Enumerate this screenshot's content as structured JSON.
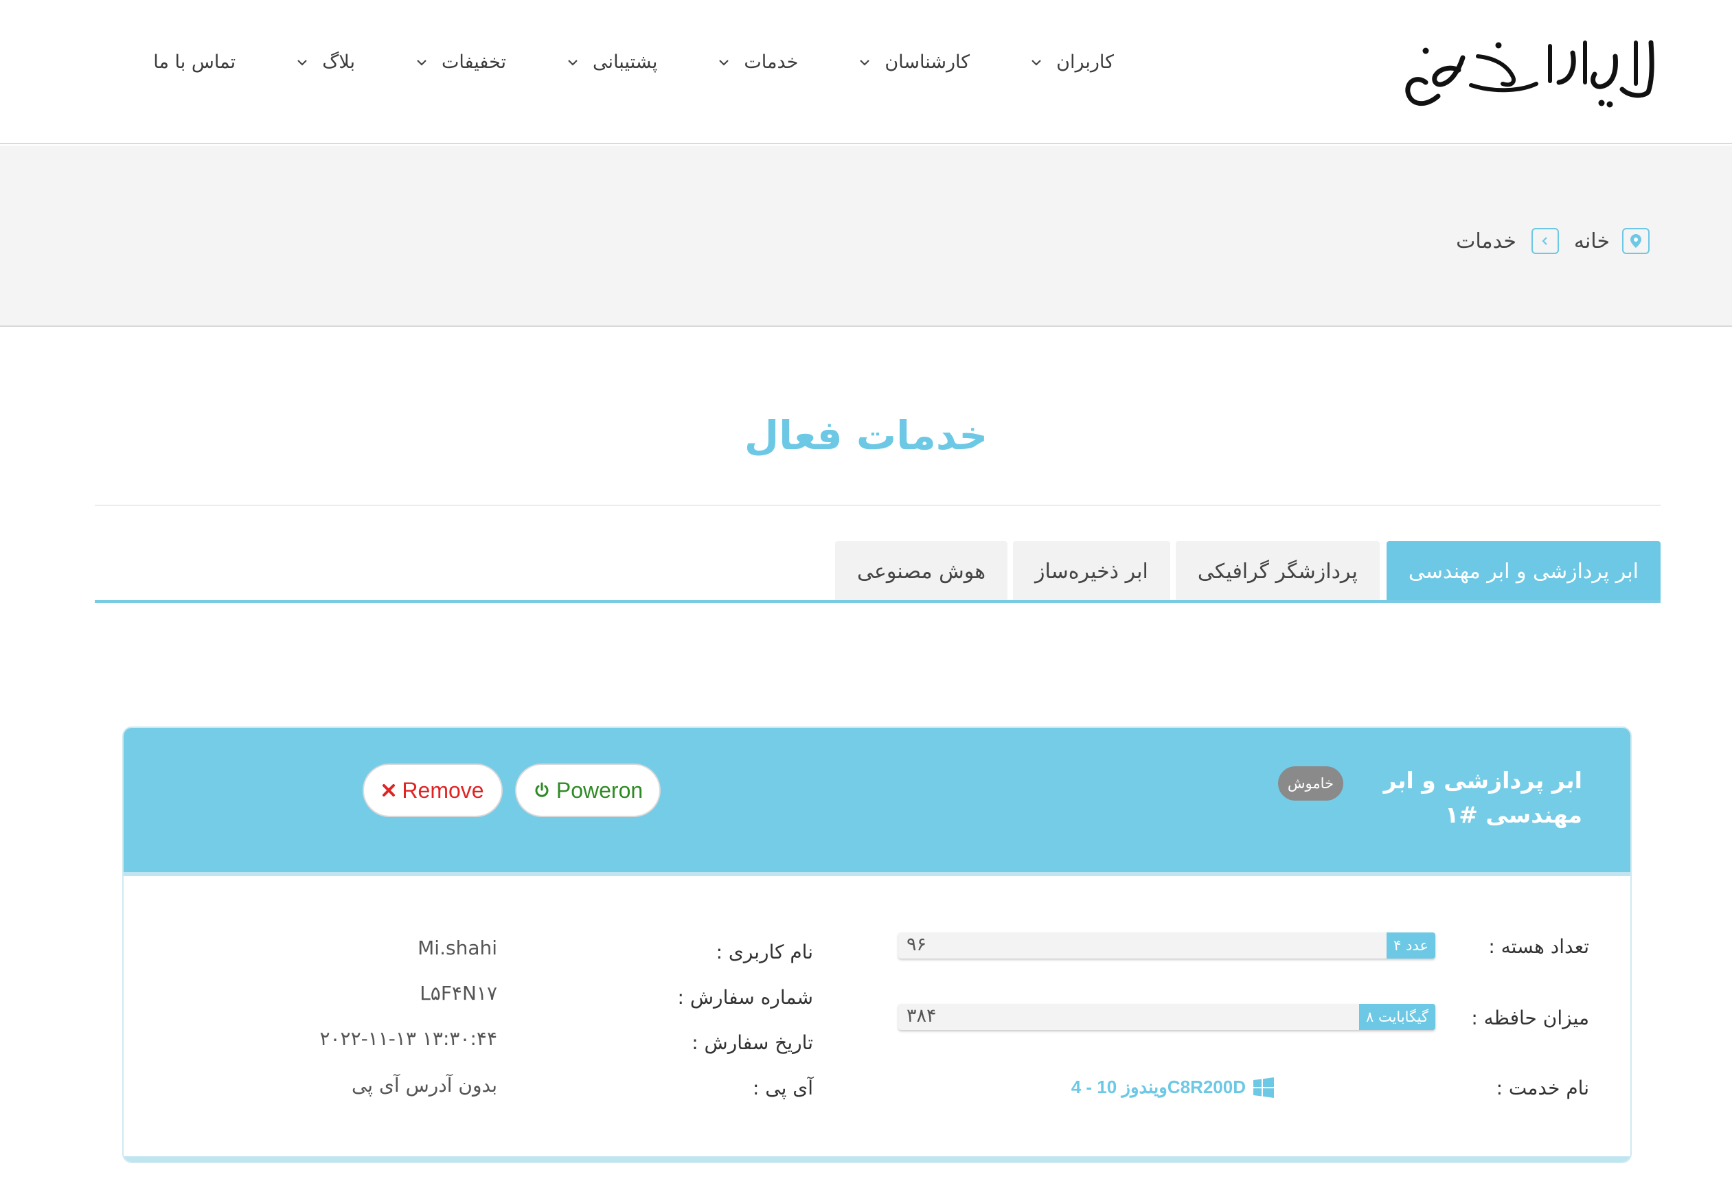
{
  "header": {
    "logo_text": "ابررایانه ملی سیمرغ",
    "nav": [
      {
        "label": "کاربران"
      },
      {
        "label": "کارشناسان"
      },
      {
        "label": "خدمات"
      },
      {
        "label": "پشتیبانی"
      },
      {
        "label": "تخفیفات"
      },
      {
        "label": "بلاگ"
      },
      {
        "label": "تماس با ما"
      }
    ]
  },
  "breadcrumb": {
    "home": "خانه",
    "current": "خدمات"
  },
  "page": {
    "title": "خدمات فعال"
  },
  "tabs": [
    {
      "label": "ابر پردازشی و ابر مهندسی",
      "active": true
    },
    {
      "label": "پردازشگر گرافیکی",
      "active": false
    },
    {
      "label": "ابر ذخیره‌ساز",
      "active": false
    },
    {
      "label": "هوش مصنوعی",
      "active": false
    }
  ],
  "service": {
    "title": "ابر پردازشی و ابر مهندسی #۱",
    "status": "خاموش",
    "poweron_label": "Poweron",
    "remove_label": "Remove",
    "cores_label": "تعداد هسته :",
    "cores_value": "۹۶",
    "cores_tag": "۴ عدد",
    "memory_label": "میزان حافظه :",
    "memory_value": "۳۸۴",
    "memory_tag": "۸ گیگابایت",
    "service_name_label": "نام خدمت :",
    "service_name_value": "ویندوز 10 - 4C8R200D",
    "username_label": "نام کاربری :",
    "username_value": "Mi.shahi",
    "order_no_label": "شماره سفارش :",
    "order_no_value": "L۵F۴N۱۷",
    "order_date_label": "تاریخ سفارش :",
    "order_date_value": "۲۰۲۲-۱۱-۱۳ ۱۳:۳۰:۴۴",
    "ip_label": "آی پی :",
    "ip_value": "بدون آدرس آی پی"
  },
  "colors": {
    "accent": "#6cc8e4",
    "card_header": "#75cce6",
    "poweron": "#2e8b24",
    "remove": "#e02424",
    "badge": "#8a8a8a"
  }
}
